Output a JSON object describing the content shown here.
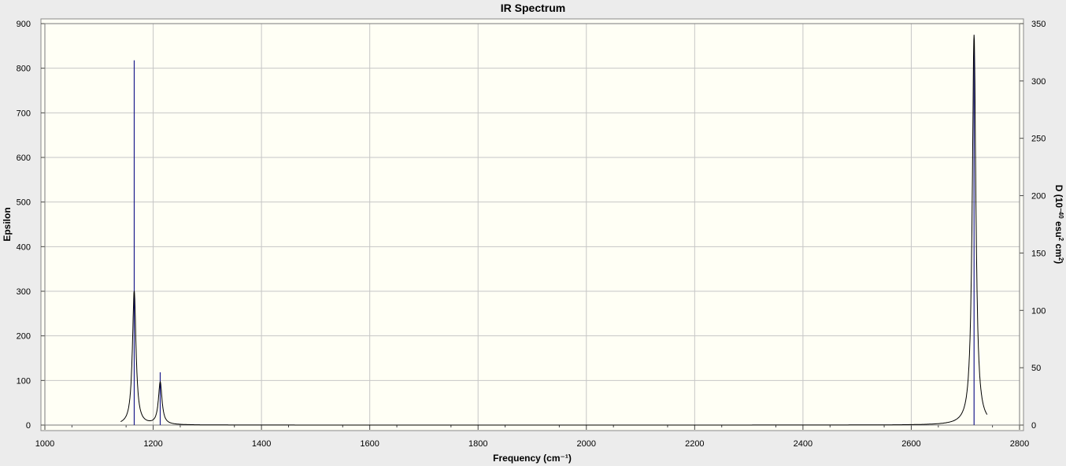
{
  "window": {
    "title": "IR Spectrum"
  },
  "chart_data": {
    "type": "line",
    "title": "IR Spectrum",
    "xlabel": "Frequency (cm⁻¹)",
    "ylabel_left": "Epsilon",
    "ylabel_right_parts": [
      "D (10",
      "−40",
      " esu",
      "2",
      " cm",
      "2",
      ")"
    ],
    "xlim": [
      1000,
      2800
    ],
    "ylim_left": [
      0,
      900
    ],
    "ylim_right": [
      0,
      350
    ],
    "x_ticks": [
      1000,
      1200,
      1400,
      1600,
      1800,
      2000,
      2200,
      2400,
      2600,
      2800
    ],
    "y_ticks_left": [
      0,
      100,
      200,
      300,
      400,
      500,
      600,
      700,
      800,
      900
    ],
    "y_ticks_right": [
      0,
      50,
      100,
      150,
      200,
      250,
      300,
      350
    ],
    "grid": true,
    "colors": {
      "background": "#fffff5",
      "grid": "#c6c6c6",
      "spectrum": "#000000",
      "sticks": "#1c1c8c",
      "frame": "#ececec"
    },
    "series": [
      {
        "kind": "spectrum",
        "axis": "left",
        "peaks": [
          {
            "center": 1165,
            "height": 300,
            "hwhm": 4
          },
          {
            "center": 1213,
            "height": 95,
            "hwhm": 4
          },
          {
            "center": 2716,
            "height": 875,
            "hwhm": 4
          }
        ],
        "x_range": [
          1140,
          2740
        ]
      },
      {
        "kind": "sticks",
        "axis": "right",
        "x": [
          1165,
          1213,
          2716
        ],
        "values": [
          318,
          46,
          335
        ]
      }
    ]
  }
}
